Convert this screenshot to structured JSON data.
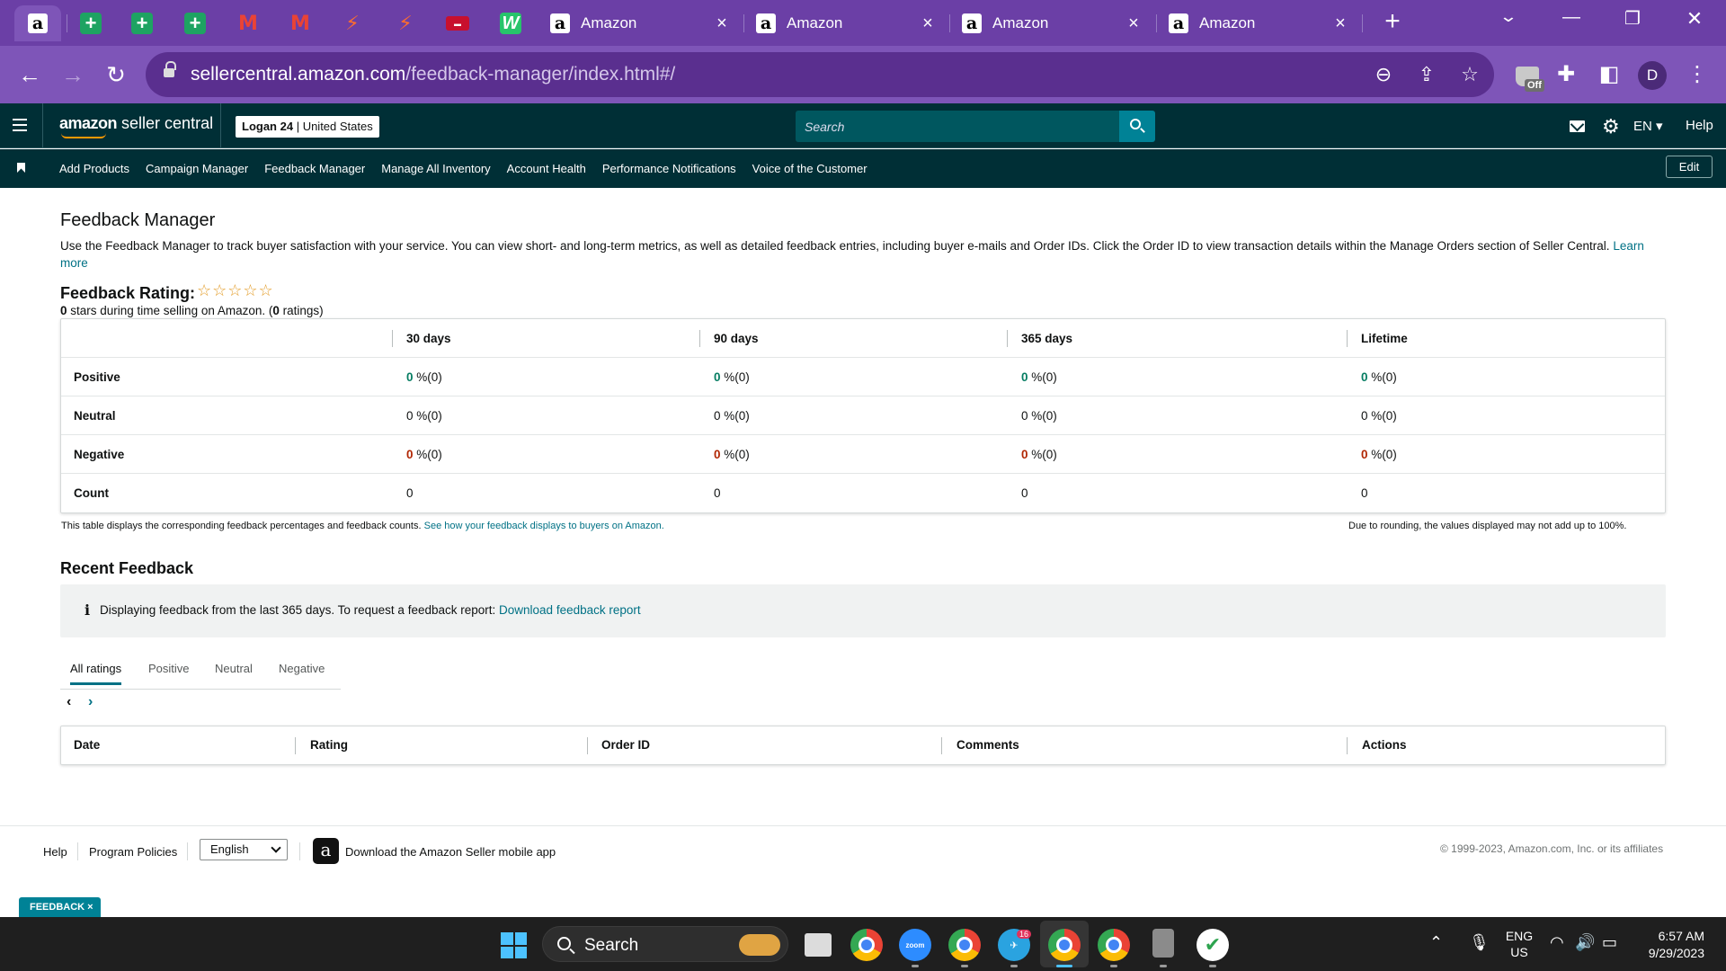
{
  "browser": {
    "tabs": [
      {
        "title": "Amazon",
        "close": "×"
      },
      {
        "title": "Amazon",
        "close": "×"
      },
      {
        "title": "Amazon",
        "close": "×"
      },
      {
        "title": "Amazon",
        "close": "×"
      }
    ],
    "url_host": "sellercentral.amazon.com",
    "url_path": "/feedback-manager/index.html#/",
    "extension_badge": "Off",
    "profile_initial": "D"
  },
  "header": {
    "logo_brand": "amazon",
    "logo_product": " seller central",
    "account_name": "Logan 24",
    "account_sep": " | ",
    "account_region": "United States",
    "search_placeholder": "Search",
    "language": "EN",
    "help": "Help"
  },
  "nav": {
    "links": [
      "Add Products",
      "Campaign Manager",
      "Feedback Manager",
      "Manage All Inventory",
      "Account Health",
      "Performance Notifications",
      "Voice of the Customer"
    ],
    "edit": "Edit"
  },
  "page": {
    "title": "Feedback Manager",
    "description": "Use the Feedback Manager to track buyer satisfaction with your service. You can view short- and long-term metrics, as well as detailed feedback entries, including buyer e-mails and Order IDs. Click the Order ID to view transaction details within the Manage Orders section of Seller Central.",
    "learn_more": "Learn more",
    "rating_label": "Feedback Rating:",
    "stars": "☆☆☆☆☆",
    "rating_stars_value": "0",
    "rating_mid": " stars during time selling on Amazon. (",
    "rating_count": "0",
    "rating_end": " ratings)"
  },
  "feedback_table": {
    "columns": [
      "30 days",
      "90 days",
      "365 days",
      "Lifetime"
    ],
    "rows": [
      {
        "label": "Positive",
        "values": [
          {
            "n": "0",
            "p": " %(0)"
          },
          {
            "n": "0",
            "p": " %(0)"
          },
          {
            "n": "0",
            "p": " %(0)"
          },
          {
            "n": "0",
            "p": " %(0)"
          }
        ]
      },
      {
        "label": "Neutral",
        "values": [
          {
            "n": "0",
            "p": " %(0)"
          },
          {
            "n": "0",
            "p": " %(0)"
          },
          {
            "n": "0",
            "p": " %(0)"
          },
          {
            "n": "0",
            "p": " %(0)"
          }
        ]
      },
      {
        "label": "Negative",
        "values": [
          {
            "n": "0",
            "p": " %(0)"
          },
          {
            "n": "0",
            "p": " %(0)"
          },
          {
            "n": "0",
            "p": " %(0)"
          },
          {
            "n": "0",
            "p": " %(0)"
          }
        ]
      },
      {
        "label": "Count",
        "values": [
          {
            "n": "0"
          },
          {
            "n": "0"
          },
          {
            "n": "0"
          },
          {
            "n": "0"
          }
        ]
      }
    ],
    "note": "This table displays the corresponding feedback percentages and feedback counts.",
    "note_link": "See how your feedback displays to buyers on Amazon.",
    "rounding_note": "Due to rounding, the values displayed may not add up to 100%."
  },
  "recent": {
    "title": "Recent Feedback",
    "info_icon": "i",
    "info_text": "Displaying feedback from the last 365 days. To request a feedback report:",
    "info_link": "Download feedback report",
    "tabs": [
      "All ratings",
      "Positive",
      "Neutral",
      "Negative"
    ],
    "prev": "‹",
    "next": "›",
    "columns": [
      "Date",
      "Rating",
      "Order ID",
      "Comments",
      "Actions"
    ]
  },
  "footer": {
    "help": "Help",
    "policies": "Program Policies",
    "language": "English",
    "app_link": "Download the Amazon Seller mobile app",
    "copyright": "© 1999-2023, Amazon.com, Inc. or its affiliates",
    "feedback_tab": "FEEDBACK ×"
  },
  "taskbar": {
    "search": "Search",
    "telegram_badge": "16",
    "lang_top": "ENG",
    "lang_bottom": "US",
    "time": "6:57 AM",
    "date": "9/29/2023"
  }
}
